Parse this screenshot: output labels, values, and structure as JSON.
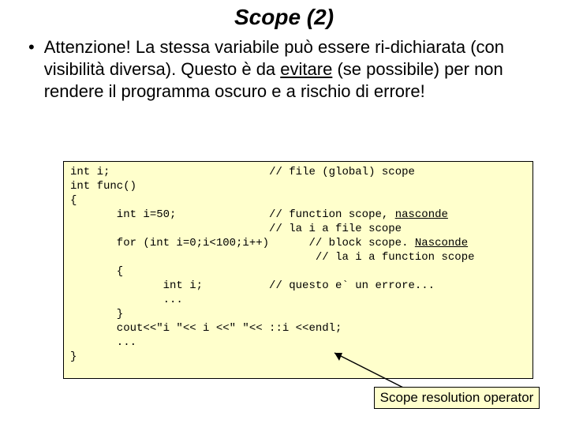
{
  "title": "Scope (2)",
  "bullet": {
    "pre": "Attenzione! La stessa variabile può essere ri-dichiarata (con visibilità diversa). Questo è da ",
    "underlined": "evitare",
    "post": " (se possibile) per non rendere il programma oscuro e a rischio di errore!"
  },
  "code": {
    "l1a": "int i;",
    "l1c": "// file (global) scope",
    "l2a": "int func()",
    "l3a": "{",
    "l4a": "       int i=50;",
    "l4c": "// function scope, ",
    "l4u": "nasconde",
    "l5c": "// la i a file scope",
    "l6a": "       for (int i=0;i<100;i++)",
    "l6c": "// block scope. ",
    "l6u": "Nasconde",
    "l7c": "// la i a function scope",
    "l8a": "       {",
    "l9a": "              int i;",
    "l9c": "// questo e` un errore...",
    "l10a": "              ...",
    "l11a": "       }",
    "l12a": "       cout<<\"i \"<< i <<\" \"<< ::i <<endl;",
    "l13a": "       ...",
    "l14a": "}"
  },
  "callout": "Scope resolution operator"
}
